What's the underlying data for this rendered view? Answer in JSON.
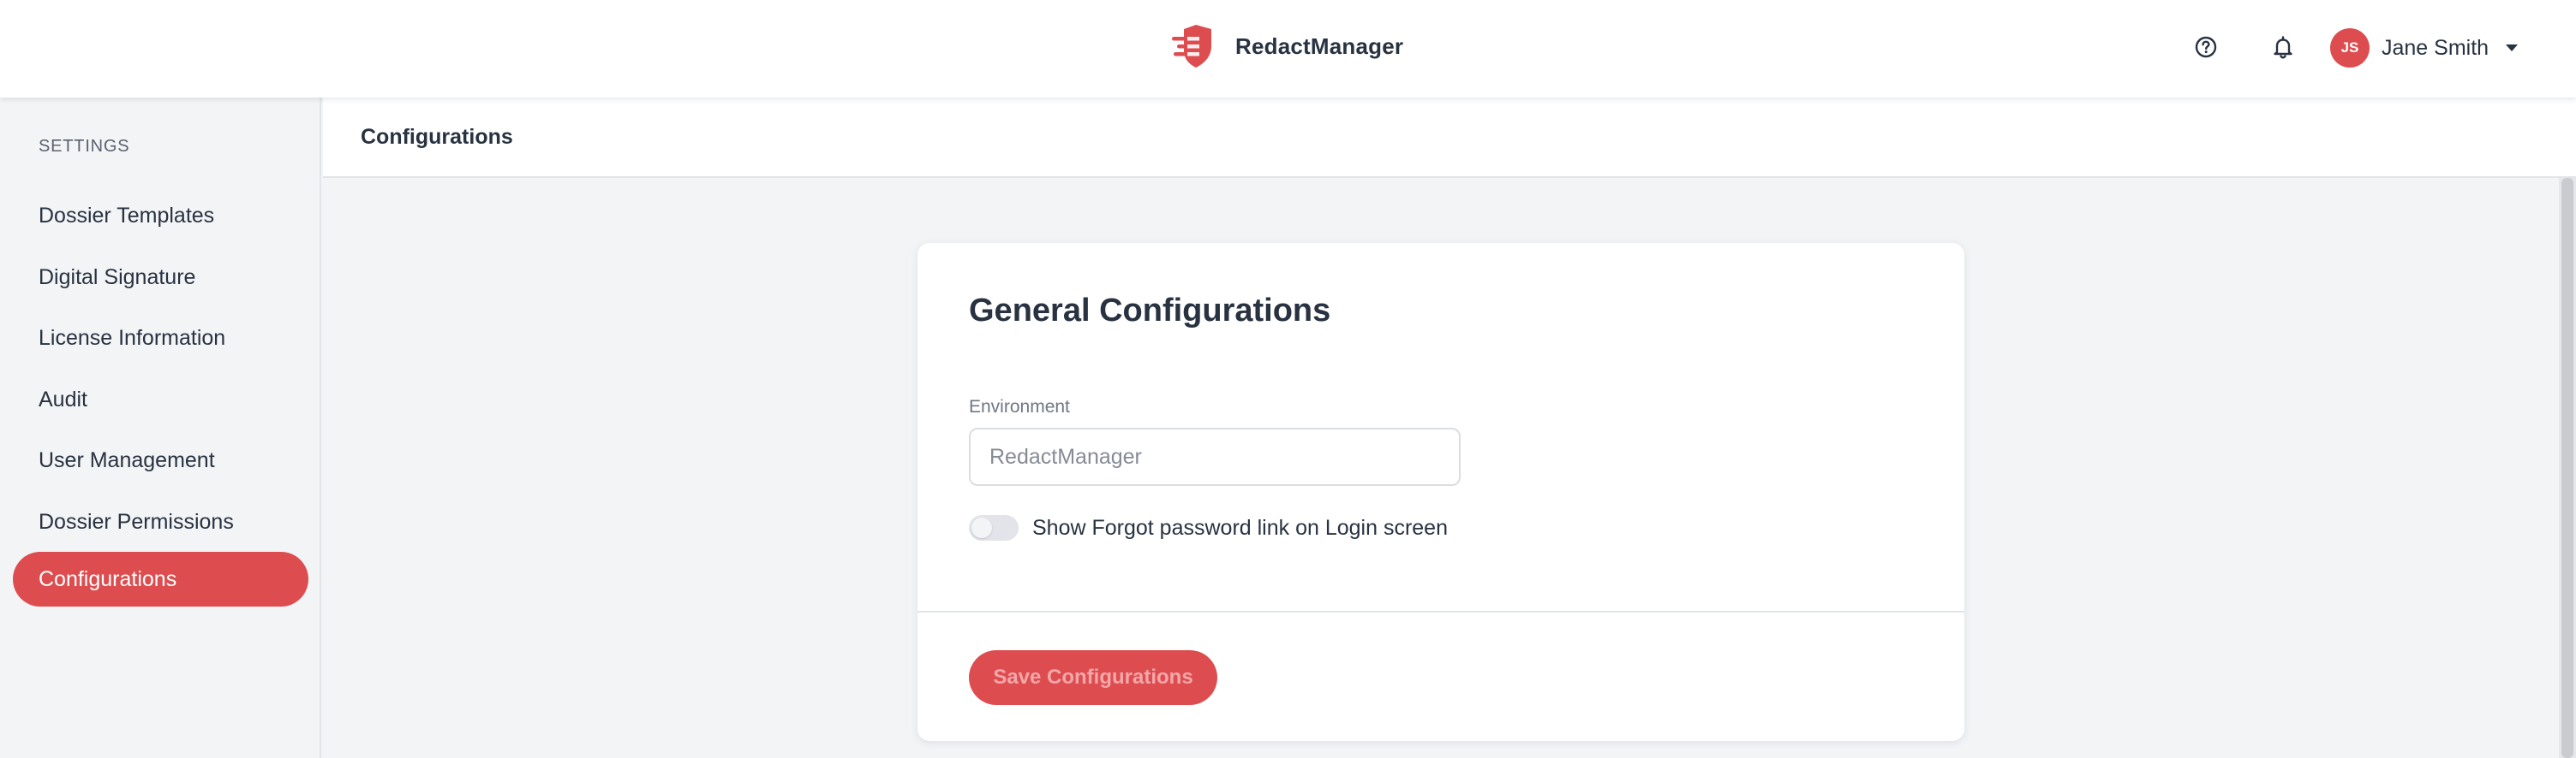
{
  "app": {
    "brand_name": "RedactManager",
    "logo_icon": "shield-logo-icon",
    "accent_color": "#dd4d50"
  },
  "header": {
    "help_icon": "question-circle-icon",
    "notifications_icon": "bell-icon",
    "user": {
      "initials": "JS",
      "name": "Jane Smith",
      "menu_icon": "caret-down-icon"
    }
  },
  "sidebar": {
    "heading": "SETTINGS",
    "items": [
      {
        "label": "Dossier Templates",
        "active": false
      },
      {
        "label": "Digital Signature",
        "active": false
      },
      {
        "label": "License Information",
        "active": false
      },
      {
        "label": "Audit",
        "active": false
      },
      {
        "label": "User Management",
        "active": false
      },
      {
        "label": "Dossier Permissions",
        "active": false
      },
      {
        "label": "Configurations",
        "active": true
      }
    ]
  },
  "page": {
    "title": "Configurations"
  },
  "card": {
    "title": "General Configurations",
    "environment": {
      "label": "Environment",
      "value": "",
      "placeholder": "RedactManager"
    },
    "forgot_password_toggle": {
      "label": "Show Forgot password link on Login screen",
      "enabled": false
    },
    "save_button_label": "Save Configurations"
  }
}
